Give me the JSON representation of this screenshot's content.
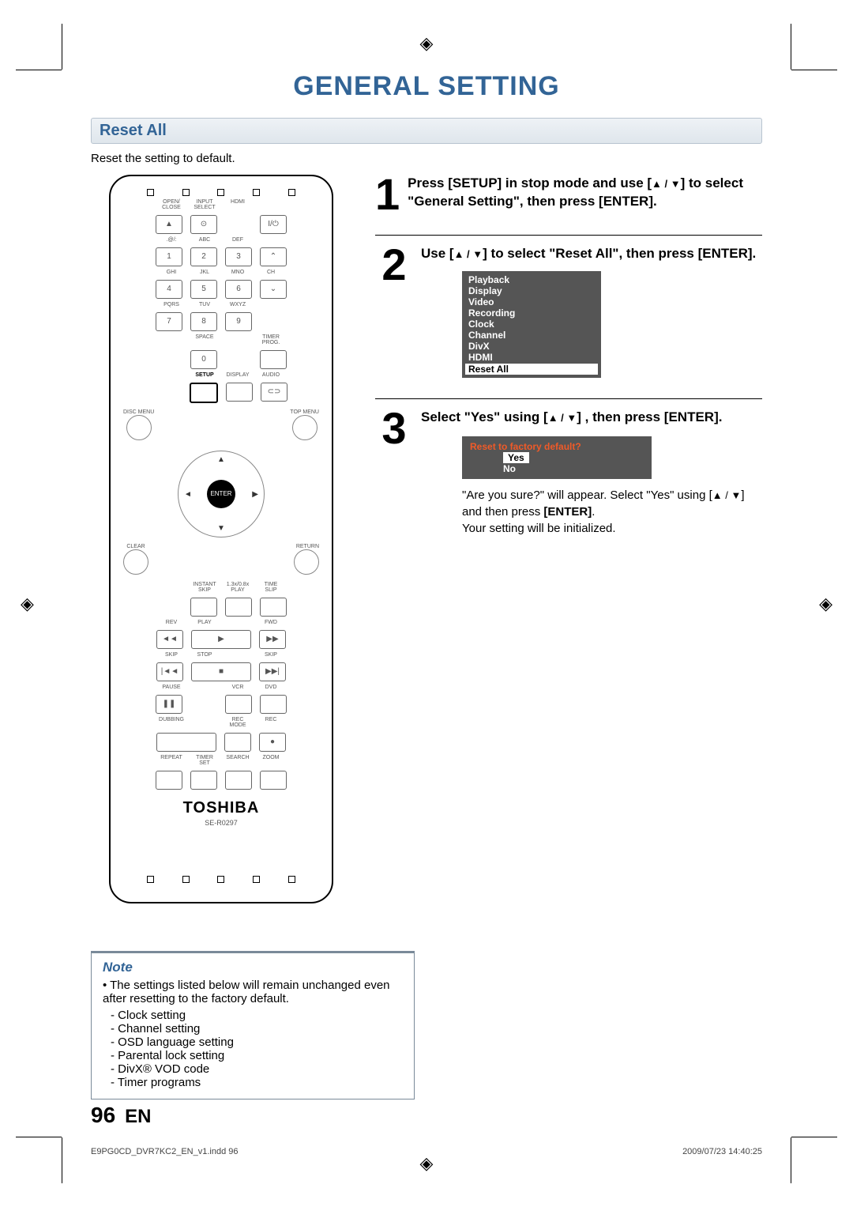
{
  "title": "GENERAL SETTING",
  "section": "Reset All",
  "intro": "Reset the setting to default.",
  "remote": {
    "row1_labels": [
      "OPEN/\nCLOSE",
      "INPUT\nSELECT",
      "HDMI",
      ""
    ],
    "row1_btns": [
      "▲",
      "⊙",
      "",
      "I/⏻"
    ],
    "row2_labels": [
      ".@/:",
      "ABC",
      "DEF",
      ""
    ],
    "row2_btns": [
      "1",
      "2",
      "3",
      "⌃"
    ],
    "row3_labels": [
      "GHI",
      "JKL",
      "MNO",
      "CH"
    ],
    "row3_btns": [
      "4",
      "5",
      "6",
      "⌄"
    ],
    "row4_labels": [
      "PQRS",
      "TUV",
      "WXYZ",
      ""
    ],
    "row4_btns": [
      "7",
      "8",
      "9",
      ""
    ],
    "row5_labels": [
      "",
      "SPACE",
      "",
      "TIMER\nPROG."
    ],
    "row5_btns": [
      "",
      "0",
      "",
      ""
    ],
    "row6_labels": [
      "",
      "SETUP",
      "DISPLAY",
      "AUDIO"
    ],
    "row6_btns": [
      "",
      "",
      "",
      "⊂⊃"
    ],
    "discmenu": "DISC MENU",
    "topmenu": "TOP MENU",
    "clear": "CLEAR",
    "return": "RETURN",
    "enter": "ENTER",
    "instant_skip": "INSTANT\nSKIP",
    "play13": "1.3x/0.8x\nPLAY",
    "timeslip": "TIME SLIP",
    "rev": "REV",
    "play": "PLAY",
    "fwd": "FWD",
    "rev_btn": "◄◄",
    "play_btn": "▶",
    "fwd_btn": "▶▶",
    "skip": "SKIP",
    "stop": "STOP",
    "skip2": "SKIP",
    "skip_btn": "|◄◄",
    "stop_btn": "■",
    "skip2_btn": "▶▶|",
    "pause": "PAUSE",
    "vcr": "VCR",
    "dvd": "DVD",
    "pause_btn": "❚❚",
    "dubbing": "DUBBING",
    "recmode": "REC MODE",
    "rec": "REC",
    "rec_btn": "●",
    "repeat": "REPEAT",
    "timerset": "TIMER SET",
    "search": "SEARCH",
    "zoom": "ZOOM",
    "brand": "TOSHIBA",
    "model": "SE-R0297"
  },
  "steps": [
    {
      "num": "1",
      "text_a": "Press [SETUP] in stop mode and use [",
      "text_b": "] to select \"General Setting\", then press [ENTER]."
    },
    {
      "num": "2",
      "text_a": "Use [",
      "text_b": "] to select \"Reset All\", then press [ENTER]."
    },
    {
      "num": "3",
      "text_a": "Select \"Yes\" using [",
      "text_b": "] , then press [ENTER]."
    }
  ],
  "menu_items": [
    "Playback",
    "Display",
    "Video",
    "Recording",
    "Clock",
    "Channel",
    "DivX",
    "HDMI",
    "Reset All"
  ],
  "menu_selected": "Reset All",
  "dialog": {
    "question": "Reset to factory default?",
    "yes": "Yes",
    "no": "No",
    "selected": "Yes"
  },
  "after_text_a": "\"Are you sure?\" will appear.  Select \"Yes\" using [",
  "after_text_b": "] and then press ",
  "after_enter": "[ENTER]",
  "after_text_c": ".",
  "after_text_d": "Your setting will be initialized.",
  "note": {
    "title": "Note",
    "lead": "• The settings listed below will remain unchanged even after resetting to the factory default.",
    "items": [
      "- Clock setting",
      "- Channel setting",
      "- OSD language setting",
      "- Parental lock setting",
      "- DivX® VOD code",
      "- Timer programs"
    ]
  },
  "pagenum": "96",
  "lang": "EN",
  "footer_left": "E9PG0CD_DVR7KC2_EN_v1.indd   96",
  "footer_right": "2009/07/23   14:40:25",
  "arrows": "▲ / ▼"
}
